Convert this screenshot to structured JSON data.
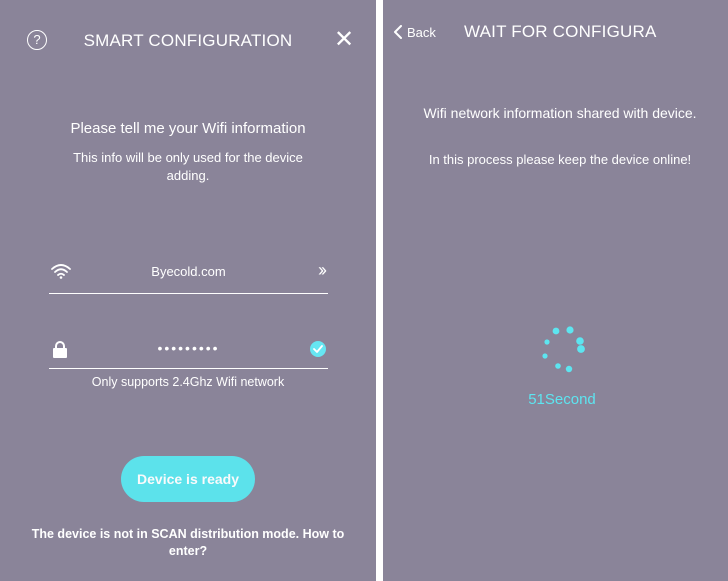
{
  "colors": {
    "background": "#8a8499",
    "accent": "#5be6ef",
    "text": "#ffffff"
  },
  "left_screen": {
    "help_icon_glyph": "?",
    "title": "SMART CONFIGURATION",
    "close_glyph": "✕",
    "intro_title": "Please tell me your Wifi information",
    "intro_desc": "This info will be only used for the device adding.",
    "wifi": {
      "icon": "wifi-icon",
      "ssid": "Byecold.com",
      "next_glyph": "››"
    },
    "password": {
      "icon": "lock-icon",
      "value": "•••••••••",
      "status_icon": "check-icon"
    },
    "wifi_note": "Only supports 2.4Ghz Wifi network",
    "ready_button": "Device is ready",
    "scan_link": "The device is not in SCAN distribution mode. How to enter?"
  },
  "right_screen": {
    "back_label": "Back",
    "title": "WAIT FOR CONFIGURA",
    "shared_msg": "Wifi network information shared with device.",
    "keep_online_msg": "In this process please keep the device online!",
    "spinner_icon": "loading-spinner-icon",
    "countdown": "51Second"
  }
}
